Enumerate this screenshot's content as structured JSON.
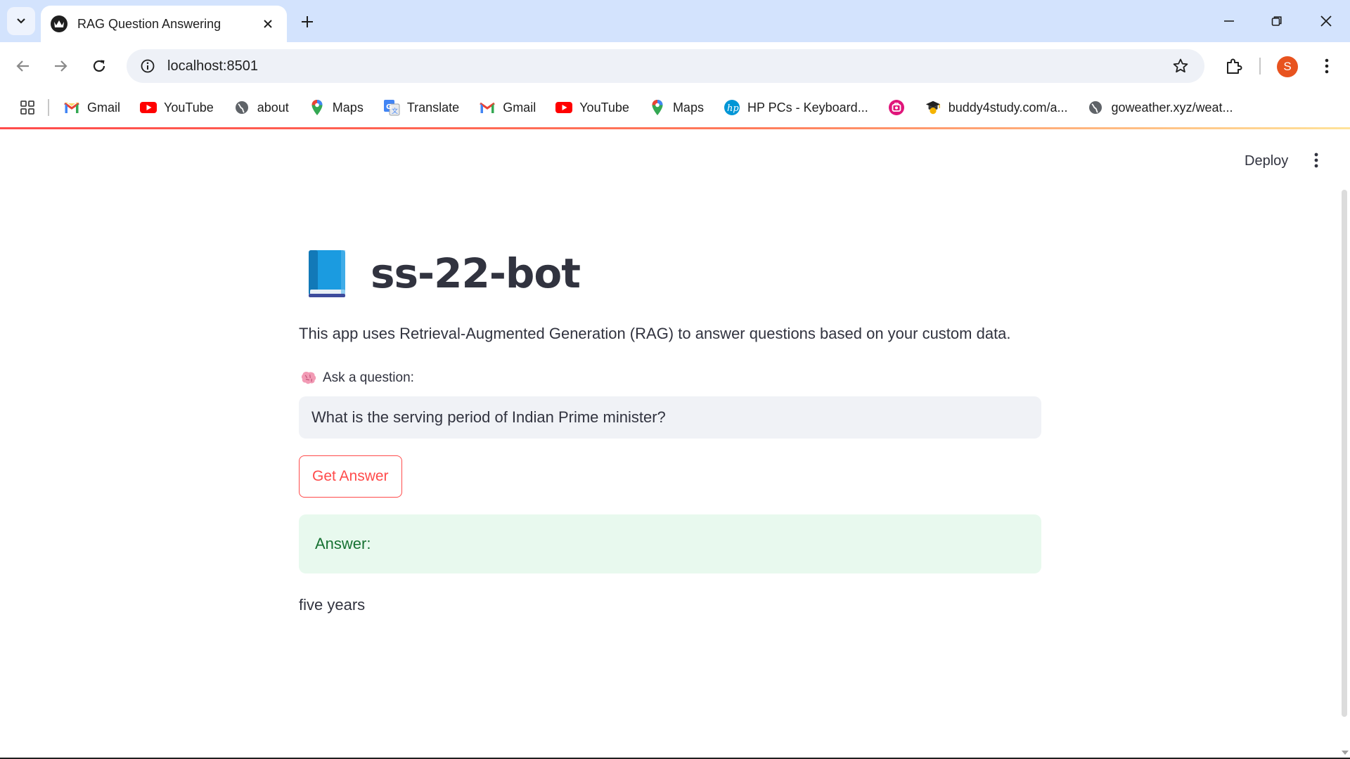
{
  "browser": {
    "tab_title": "RAG Question Answering",
    "url": "localhost:8501",
    "profile_initial": "S",
    "bookmarks": [
      {
        "label": "Gmail",
        "icon": "gmail-icon"
      },
      {
        "label": "YouTube",
        "icon": "youtube-icon"
      },
      {
        "label": "about",
        "icon": "globe-icon"
      },
      {
        "label": "Maps",
        "icon": "maps-icon"
      },
      {
        "label": "Translate",
        "icon": "translate-icon"
      },
      {
        "label": "Gmail",
        "icon": "gmail-icon"
      },
      {
        "label": "YouTube",
        "icon": "youtube-icon"
      },
      {
        "label": "Maps",
        "icon": "maps-icon"
      },
      {
        "label": "HP PCs - Keyboard...",
        "icon": "hp-icon"
      },
      {
        "label": "",
        "icon": "pink-bookmark-icon"
      },
      {
        "label": "buddy4study.com/a...",
        "icon": "graduation-cap-icon"
      },
      {
        "label": "goweather.xyz/weat...",
        "icon": "globe-icon"
      }
    ]
  },
  "app": {
    "deploy_label": "Deploy",
    "title": "ss-22-bot",
    "title_emoji": "blue-book-icon",
    "description": "This app uses Retrieval-Augmented Generation (RAG) to answer questions based on your custom data.",
    "question_label": "Ask a question:",
    "question_label_emoji": "brain-icon",
    "question_value": "What is the serving period of Indian Prime minister?",
    "button_label": "Get Answer",
    "answer_label": "Answer:",
    "answer_text": "five years"
  },
  "colors": {
    "accent": "#ff4b4b",
    "success_bg": "#e8f9ee",
    "success_text": "#177233",
    "tabstrip": "#d3e3fd"
  }
}
